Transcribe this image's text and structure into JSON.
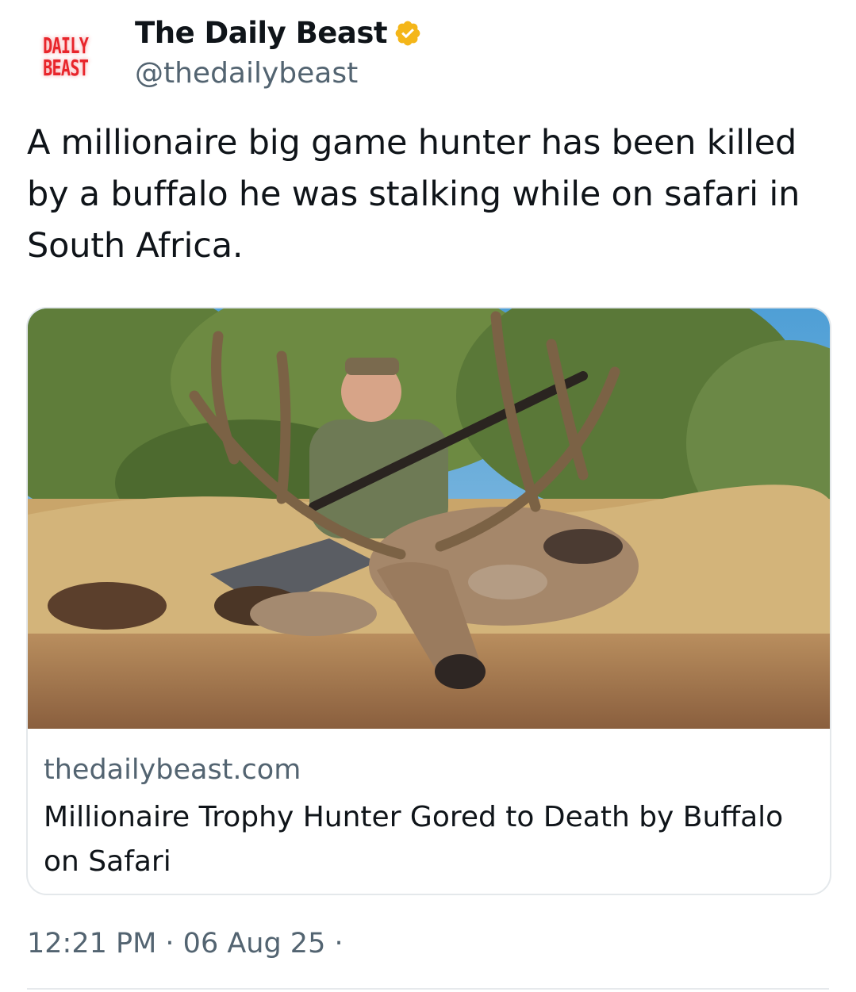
{
  "author": {
    "avatar_lines": [
      "DAILY",
      "BEAST"
    ],
    "name": "The Daily Beast",
    "handle": "@thedailybeast",
    "verified_icon": "verified-badge-icon",
    "badge_color": "#f4b619"
  },
  "tweet": {
    "text": "A millionaire big game hunter has been killed by a buffalo he was stalking while on safari in South Africa."
  },
  "card": {
    "image_icon": "hunter-with-deer-photo",
    "domain": "thedailybeast.com",
    "title": "Millionaire Trophy Hunter Gored to Death by Buffalo on Safari"
  },
  "footer": {
    "timestamp": "12:21 PM · 06 Aug 25 ·"
  },
  "colors": {
    "text": "#0f1419",
    "secondary": "#536471",
    "brand_red": "#e8252b"
  }
}
